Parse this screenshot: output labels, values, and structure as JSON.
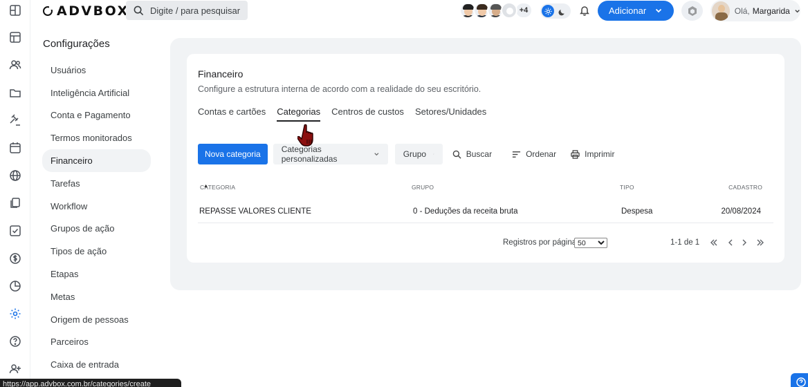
{
  "brand": {
    "logo_text": "ADVBOX"
  },
  "search": {
    "placeholder": "Digite / para pesquisar"
  },
  "header": {
    "more_users": "+4",
    "add_label": "Adicionar",
    "greeting": "Olá,",
    "user_name": "Margarida"
  },
  "colors": {
    "accent": "#1a73e8",
    "panel": "#f1f3f5"
  },
  "rail_icons": [
    "grid-icon",
    "calendar-board-icon",
    "users-icon",
    "folder-icon",
    "gavel-icon",
    "calendar-icon",
    "globe-icon",
    "documents-icon",
    "check-square-icon",
    "dollar-icon",
    "pie-chart-icon",
    "settings-icon",
    "help-icon",
    "add-user-icon"
  ],
  "sidebar": {
    "title": "Configurações",
    "items": [
      {
        "label": "Usuários"
      },
      {
        "label": "Inteligência Artificial"
      },
      {
        "label": "Conta e Pagamento"
      },
      {
        "label": "Termos monitorados"
      },
      {
        "label": "Financeiro"
      },
      {
        "label": "Tarefas"
      },
      {
        "label": "Workflow"
      },
      {
        "label": "Grupos de ação"
      },
      {
        "label": "Tipos de ação"
      },
      {
        "label": "Etapas"
      },
      {
        "label": "Metas"
      },
      {
        "label": "Origem de pessoas"
      },
      {
        "label": "Parceiros"
      },
      {
        "label": "Caixa de entrada"
      }
    ],
    "active_index": 4
  },
  "main": {
    "title": "Financeiro",
    "subtitle": "Configure a estrutura interna de acordo com a realidade do seu escritório.",
    "tabs": [
      {
        "label": "Contas e cartões"
      },
      {
        "label": "Categorias"
      },
      {
        "label": "Centros de custos"
      },
      {
        "label": "Setores/Unidades"
      }
    ],
    "active_tab": 1,
    "toolbar": {
      "new_label": "Nova categoria",
      "custom_select": "Categorias personalizadas",
      "group_select": "Grupo",
      "search_label": "Buscar",
      "sort_label": "Ordenar",
      "print_label": "Imprimir"
    },
    "table": {
      "columns": [
        "CATEGORIA",
        "GRUPO",
        "TIPO",
        "CADASTRO"
      ],
      "sort_indicator": "▲",
      "rows": [
        [
          "REPASSE VALORES CLIENTE",
          "0 - Deduções da receita bruta",
          "Despesa",
          "20/08/2024"
        ]
      ]
    },
    "pagination": {
      "rows_per_page_label": "Registros por página",
      "rows_per_page": "50",
      "range": "1-1 de 1"
    }
  },
  "status_url": "https://app.advbox.com.br/categories/create"
}
